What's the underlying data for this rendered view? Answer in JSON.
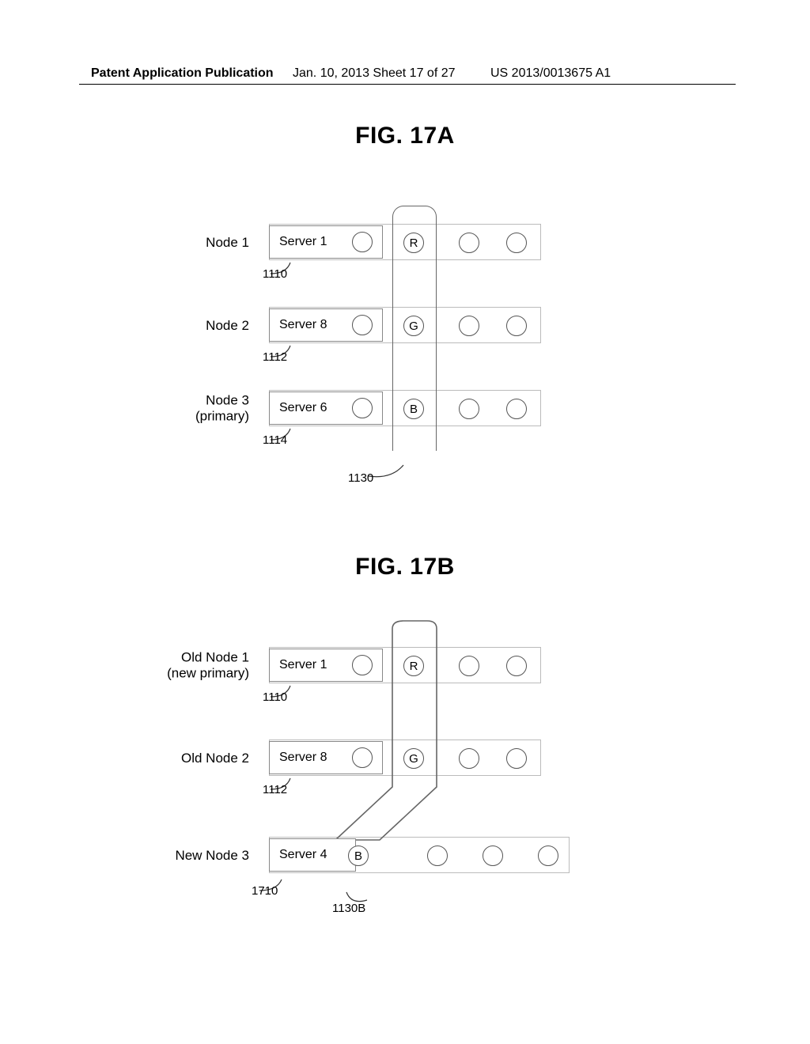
{
  "header": {
    "left": "Patent Application Publication",
    "mid": "Jan. 10, 2013  Sheet 17 of 27",
    "right": "US 2013/0013675 A1"
  },
  "figA": {
    "title": "FIG. 17A",
    "rows": [
      {
        "node": "Node 1",
        "server": "Server 1",
        "ref": "1110",
        "letter": "R"
      },
      {
        "node": "Node 2",
        "server": "Server 8",
        "ref": "1112",
        "letter": "G"
      },
      {
        "node": "Node 3\n(primary)",
        "server": "Server 6",
        "ref": "1114",
        "letter": "B"
      }
    ],
    "column_ref": "1130"
  },
  "figB": {
    "title": "FIG. 17B",
    "rows": [
      {
        "node": "Old Node 1\n(new primary)",
        "server": "Server 1",
        "ref": "1110",
        "letter": "R"
      },
      {
        "node": "Old Node 2",
        "server": "Server 8",
        "ref": "1112",
        "letter": "G"
      },
      {
        "node": "New Node 3",
        "server": "Server 4",
        "ref": "1710",
        "letter": "B"
      }
    ],
    "column_ref": "1130B"
  }
}
